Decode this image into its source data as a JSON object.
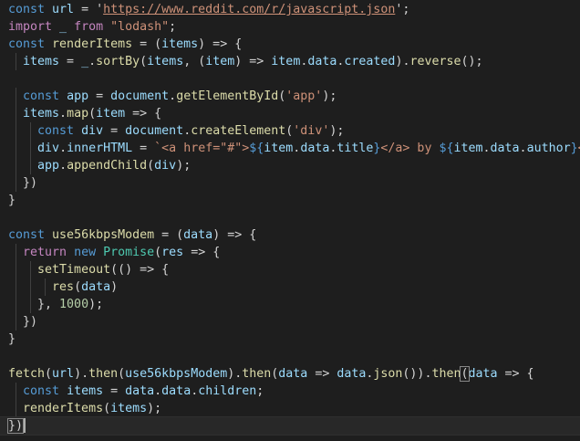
{
  "editor": {
    "lines": [
      [
        {
          "t": "const ",
          "c": "kw"
        },
        {
          "t": "url",
          "c": "var"
        },
        {
          "t": " = '",
          "c": "punc"
        },
        {
          "t": "https://www.reddit.com/r/javascript.json",
          "c": "url"
        },
        {
          "t": "';",
          "c": "punc"
        }
      ],
      [
        {
          "t": "import ",
          "c": "kwf"
        },
        {
          "t": "_ ",
          "c": "var"
        },
        {
          "t": "from ",
          "c": "kwf"
        },
        {
          "t": "\"lodash\"",
          "c": "str"
        },
        {
          "t": ";",
          "c": "punc"
        }
      ],
      [
        {
          "t": "const ",
          "c": "kw"
        },
        {
          "t": "renderItems",
          "c": "fn"
        },
        {
          "t": " = (",
          "c": "punc"
        },
        {
          "t": "items",
          "c": "var"
        },
        {
          "t": ") => {",
          "c": "punc"
        }
      ],
      [
        {
          "t": "  ",
          "c": "punc"
        },
        {
          "t": "items",
          "c": "var"
        },
        {
          "t": " = ",
          "c": "punc"
        },
        {
          "t": "_",
          "c": "var"
        },
        {
          "t": ".",
          "c": "punc"
        },
        {
          "t": "sortBy",
          "c": "fn"
        },
        {
          "t": "(",
          "c": "punc"
        },
        {
          "t": "items",
          "c": "var"
        },
        {
          "t": ", (",
          "c": "punc"
        },
        {
          "t": "item",
          "c": "var"
        },
        {
          "t": ") => ",
          "c": "punc"
        },
        {
          "t": "item",
          "c": "var"
        },
        {
          "t": ".",
          "c": "punc"
        },
        {
          "t": "data",
          "c": "var"
        },
        {
          "t": ".",
          "c": "punc"
        },
        {
          "t": "created",
          "c": "var"
        },
        {
          "t": ").",
          "c": "punc"
        },
        {
          "t": "reverse",
          "c": "fn"
        },
        {
          "t": "();",
          "c": "punc"
        }
      ],
      [],
      [
        {
          "t": "  ",
          "c": "punc"
        },
        {
          "t": "const ",
          "c": "kw"
        },
        {
          "t": "app",
          "c": "var"
        },
        {
          "t": " = ",
          "c": "punc"
        },
        {
          "t": "document",
          "c": "var"
        },
        {
          "t": ".",
          "c": "punc"
        },
        {
          "t": "getElementById",
          "c": "fn"
        },
        {
          "t": "(",
          "c": "punc"
        },
        {
          "t": "'app'",
          "c": "str"
        },
        {
          "t": ");",
          "c": "punc"
        }
      ],
      [
        {
          "t": "  ",
          "c": "punc"
        },
        {
          "t": "items",
          "c": "var"
        },
        {
          "t": ".",
          "c": "punc"
        },
        {
          "t": "map",
          "c": "fn"
        },
        {
          "t": "(",
          "c": "punc"
        },
        {
          "t": "item",
          "c": "var"
        },
        {
          "t": " => {",
          "c": "punc"
        }
      ],
      [
        {
          "t": "    ",
          "c": "punc"
        },
        {
          "t": "const ",
          "c": "kw"
        },
        {
          "t": "div",
          "c": "var"
        },
        {
          "t": " = ",
          "c": "punc"
        },
        {
          "t": "document",
          "c": "var"
        },
        {
          "t": ".",
          "c": "punc"
        },
        {
          "t": "createElement",
          "c": "fn"
        },
        {
          "t": "(",
          "c": "punc"
        },
        {
          "t": "'div'",
          "c": "str"
        },
        {
          "t": ");",
          "c": "punc"
        }
      ],
      [
        {
          "t": "    ",
          "c": "punc"
        },
        {
          "t": "div",
          "c": "var"
        },
        {
          "t": ".",
          "c": "punc"
        },
        {
          "t": "innerHTML",
          "c": "var"
        },
        {
          "t": " = ",
          "c": "punc"
        },
        {
          "t": "`<a href=\"#\">",
          "c": "str"
        },
        {
          "t": "${",
          "c": "ph"
        },
        {
          "t": "item",
          "c": "var"
        },
        {
          "t": ".",
          "c": "punc"
        },
        {
          "t": "data",
          "c": "var"
        },
        {
          "t": ".",
          "c": "punc"
        },
        {
          "t": "title",
          "c": "var"
        },
        {
          "t": "}",
          "c": "ph"
        },
        {
          "t": "</a> by ",
          "c": "str"
        },
        {
          "t": "${",
          "c": "ph"
        },
        {
          "t": "item",
          "c": "var"
        },
        {
          "t": ".",
          "c": "punc"
        },
        {
          "t": "data",
          "c": "var"
        },
        {
          "t": ".",
          "c": "punc"
        },
        {
          "t": "author",
          "c": "var"
        },
        {
          "t": "}",
          "c": "ph"
        },
        {
          "t": "<br",
          "c": "str"
        }
      ],
      [
        {
          "t": "    ",
          "c": "punc"
        },
        {
          "t": "app",
          "c": "var"
        },
        {
          "t": ".",
          "c": "punc"
        },
        {
          "t": "appendChild",
          "c": "fn"
        },
        {
          "t": "(",
          "c": "punc"
        },
        {
          "t": "div",
          "c": "var"
        },
        {
          "t": ");",
          "c": "punc"
        }
      ],
      [
        {
          "t": "  })",
          "c": "punc"
        }
      ],
      [
        {
          "t": "}",
          "c": "punc"
        }
      ],
      [],
      [
        {
          "t": "const ",
          "c": "kw"
        },
        {
          "t": "use56kbpsModem",
          "c": "fn"
        },
        {
          "t": " = (",
          "c": "punc"
        },
        {
          "t": "data",
          "c": "var"
        },
        {
          "t": ") => {",
          "c": "punc"
        }
      ],
      [
        {
          "t": "  ",
          "c": "punc"
        },
        {
          "t": "return ",
          "c": "kwf"
        },
        {
          "t": "new ",
          "c": "kw"
        },
        {
          "t": "Promise",
          "c": "obj"
        },
        {
          "t": "(",
          "c": "punc"
        },
        {
          "t": "res",
          "c": "var"
        },
        {
          "t": " => {",
          "c": "punc"
        }
      ],
      [
        {
          "t": "    ",
          "c": "punc"
        },
        {
          "t": "setTimeout",
          "c": "fn"
        },
        {
          "t": "(() => {",
          "c": "punc"
        }
      ],
      [
        {
          "t": "      ",
          "c": "punc"
        },
        {
          "t": "res",
          "c": "fn"
        },
        {
          "t": "(",
          "c": "punc"
        },
        {
          "t": "data",
          "c": "var"
        },
        {
          "t": ")",
          "c": "punc"
        }
      ],
      [
        {
          "t": "    }, ",
          "c": "punc"
        },
        {
          "t": "1000",
          "c": "num"
        },
        {
          "t": ");",
          "c": "punc"
        }
      ],
      [
        {
          "t": "  })",
          "c": "punc"
        }
      ],
      [
        {
          "t": "}",
          "c": "punc"
        }
      ],
      [],
      [
        {
          "t": "fetch",
          "c": "fn"
        },
        {
          "t": "(",
          "c": "punc"
        },
        {
          "t": "url",
          "c": "var"
        },
        {
          "t": ").",
          "c": "punc"
        },
        {
          "t": "then",
          "c": "fn"
        },
        {
          "t": "(",
          "c": "punc"
        },
        {
          "t": "use56kbpsModem",
          "c": "var"
        },
        {
          "t": ").",
          "c": "punc"
        },
        {
          "t": "then",
          "c": "fn"
        },
        {
          "t": "(",
          "c": "punc"
        },
        {
          "t": "data",
          "c": "var"
        },
        {
          "t": " => ",
          "c": "punc"
        },
        {
          "t": "data",
          "c": "var"
        },
        {
          "t": ".",
          "c": "punc"
        },
        {
          "t": "json",
          "c": "fn"
        },
        {
          "t": "()).",
          "c": "punc"
        },
        {
          "t": "then",
          "c": "fn"
        },
        {
          "t": "(",
          "c": "punc",
          "m": true
        },
        {
          "t": "data",
          "c": "var"
        },
        {
          "t": " => {",
          "c": "punc"
        }
      ],
      [
        {
          "t": "  ",
          "c": "punc"
        },
        {
          "t": "const ",
          "c": "kw"
        },
        {
          "t": "items",
          "c": "var"
        },
        {
          "t": " = ",
          "c": "punc"
        },
        {
          "t": "data",
          "c": "var"
        },
        {
          "t": ".",
          "c": "punc"
        },
        {
          "t": "data",
          "c": "var"
        },
        {
          "t": ".",
          "c": "punc"
        },
        {
          "t": "children",
          "c": "var"
        },
        {
          "t": ";",
          "c": "punc"
        }
      ],
      [
        {
          "t": "  ",
          "c": "punc"
        },
        {
          "t": "renderItems",
          "c": "fn"
        },
        {
          "t": "(",
          "c": "punc"
        },
        {
          "t": "items",
          "c": "var"
        },
        {
          "t": ");",
          "c": "punc"
        }
      ],
      [
        {
          "t": "})",
          "c": "punc",
          "m": true
        }
      ]
    ],
    "current_line": 24,
    "indent_guides": [
      0,
      0,
      0,
      1,
      0,
      1,
      1,
      2,
      2,
      2,
      1,
      0,
      0,
      0,
      1,
      2,
      3,
      2,
      1,
      0,
      0,
      0,
      1,
      1,
      0
    ],
    "colors": {
      "background": "#1e1e1e",
      "current_line": "#282828",
      "keyword": "#569cd6",
      "control": "#c586c0",
      "function": "#dcdcaa",
      "variable": "#9cdcfe",
      "string": "#ce9178",
      "number": "#b5cea8",
      "class": "#4ec9b0"
    }
  }
}
